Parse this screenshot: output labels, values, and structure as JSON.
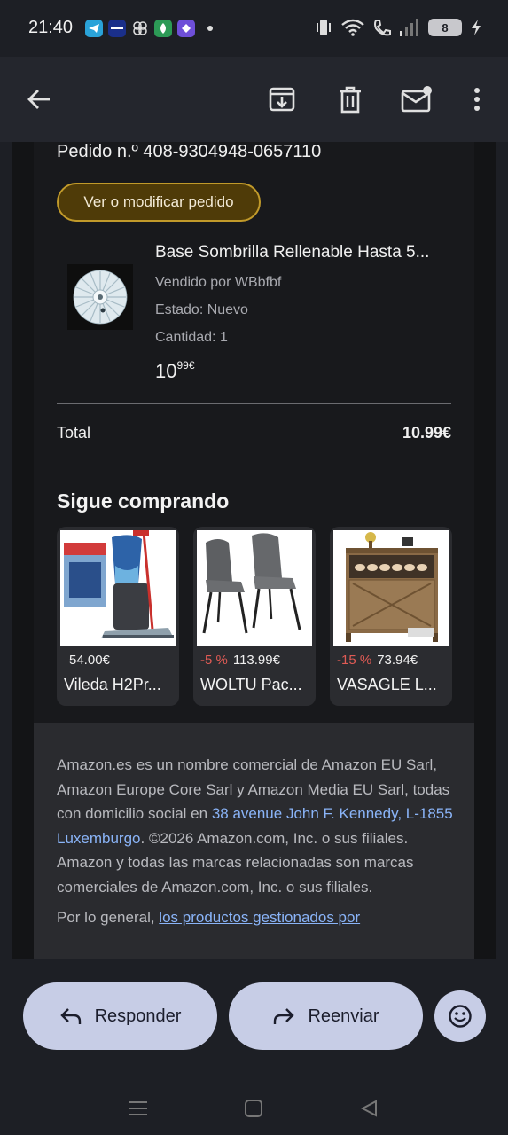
{
  "status_bar": {
    "time": "21:40",
    "battery": "8",
    "app_icons": [
      "telegram-icon",
      "bank-app-icon",
      "pinwheel-icon",
      "green-leaf-icon",
      "purple-app-icon"
    ],
    "system_icons": [
      "vibrate-icon",
      "wifi-icon",
      "wifi-call-icon",
      "signal-icon",
      "battery-icon",
      "charging-icon"
    ]
  },
  "toolbar": {
    "icons": [
      "back-arrow-icon",
      "archive-icon",
      "trash-icon",
      "mark-unread-icon",
      "more-vert-icon"
    ]
  },
  "order": {
    "number": "Pedido n.º 408-9304948-0657110",
    "button_label": "Ver o modificar pedido",
    "accent": "#c19a2a"
  },
  "product": {
    "title": "Base Sombrilla Rellenable Hasta 5...",
    "seller": "Vendido por WBbfbf",
    "condition": "Estado: Nuevo",
    "quantity": "Cantidad: 1",
    "price_whole": "10",
    "price_fraction": "99€"
  },
  "total": {
    "label": "Total",
    "value": "10.99€"
  },
  "recommendations": {
    "title": "Sigue comprando",
    "items": [
      {
        "discount": "",
        "price": "54.00€",
        "name": "Vileda H2Pr..."
      },
      {
        "discount": "-5 %",
        "price": "113.99€",
        "name": "WOLTU Pac..."
      },
      {
        "discount": "-15 %",
        "price": "73.94€",
        "name": "VASAGLE L..."
      }
    ]
  },
  "footer": {
    "text_before_link": "Amazon.es es un nombre comercial de Amazon EU Sarl, Amazon Europe Core Sarl y Amazon Media EU Sarl, todas con domicilio social en ",
    "address_link": "38 avenue John F. Kennedy, L-1855 Luxemburgo",
    "text_after_link": ". ©2026 Amazon.com, Inc. o sus filiales. Amazon y todas las marcas relacionadas son marcas comerciales de Amazon.com, Inc. o sus filiales.",
    "cut_text": "Por lo general, ",
    "cut_link": "los productos gestionados por"
  },
  "actions": {
    "reply_label": "Responder",
    "forward_label": "Reenviar"
  },
  "nav_bar": {
    "icons": [
      "menu-icon",
      "home-icon",
      "back-icon"
    ]
  }
}
